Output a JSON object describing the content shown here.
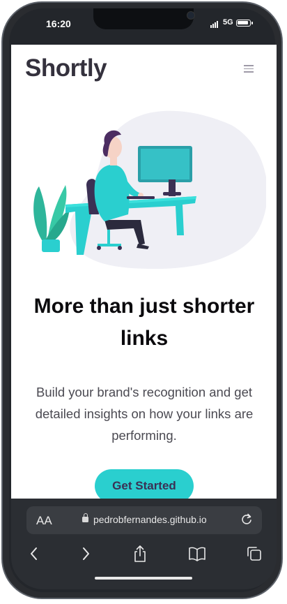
{
  "status": {
    "time": "16:20",
    "network": "5G"
  },
  "header": {
    "logo": "Shortly"
  },
  "hero": {
    "headline": "More than just shorter links",
    "subtext": "Build your brand's recognition and get detailed insights on how your links are performing.",
    "cta_label": "Get Started"
  },
  "browser": {
    "text_size_label": "AA",
    "url": "pedrobfernandes.github.io"
  },
  "colors": {
    "accent": "#2acfcf",
    "logo": "#34313d",
    "cta_text": "#3b3054"
  }
}
